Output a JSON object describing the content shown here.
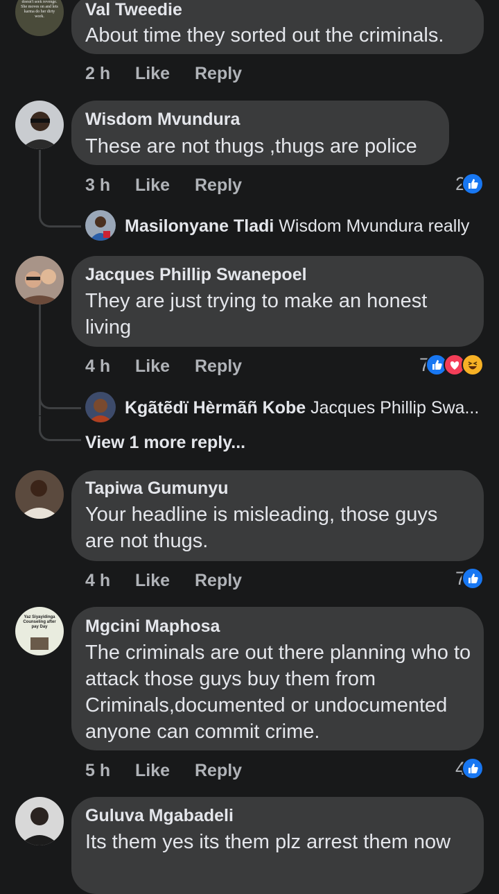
{
  "colors": {
    "background": "#18191a",
    "bubble": "#3a3b3c",
    "meta_text": "#b0b3b8",
    "like_blue": "#1877f2",
    "love_red": "#f33e58",
    "haha_yellow": "#f7b125"
  },
  "actions": {
    "like": "Like",
    "reply": "Reply"
  },
  "comments": [
    {
      "author": "Val Tweedie",
      "text": "About time they sorted out the criminals.",
      "time": "2 h",
      "reaction_count": "",
      "avatar_text": "doesn't seek revenge. She moves on and lets karma do her dirty work."
    },
    {
      "author": "Wisdom Mvundura",
      "text": "These are not thugs ,thugs are police",
      "time": "3 h",
      "reaction_count": "2",
      "reply": {
        "author": "Masilonyane Tladi",
        "text": "Wisdom Mvundura really"
      }
    },
    {
      "author": "Jacques Phillip Swanepoel",
      "text": "They are just trying to make an honest living",
      "time": "4 h",
      "reaction_count": "7",
      "reply": {
        "author": "Kgãtẽdï Hèrmãñ Kobe",
        "text": "Jacques Phillip Swa..."
      },
      "more_replies": "View 1 more reply..."
    },
    {
      "author": "Tapiwa Gumunyu",
      "text": "Your headline is misleading, those guys are not thugs.",
      "time": "4 h",
      "reaction_count": "7"
    },
    {
      "author": "Mgcini Maphosa",
      "text": "The criminals are out there planning who to attack those guys buy them from Criminals,documented or undocumented anyone can commit crime.",
      "time": "5 h",
      "reaction_count": "4",
      "avatar_text": "Yaz Siyayidinga Counseling after pay Day"
    },
    {
      "author": "Guluva Mgabadeli",
      "text": "Its them yes its them plz arrest them now"
    }
  ]
}
